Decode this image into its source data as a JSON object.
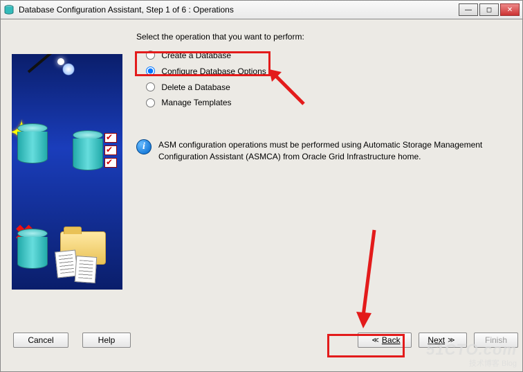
{
  "window": {
    "title": "Database Configuration Assistant, Step 1 of 6 : Operations"
  },
  "prompt": "Select the operation that you want to perform:",
  "options": {
    "create": {
      "label": "Create a Database",
      "value": "create"
    },
    "configure": {
      "label": "Configure Database Options",
      "value": "configure"
    },
    "delete": {
      "label": "Delete a Database",
      "value": "delete"
    },
    "manage": {
      "label": "Manage Templates",
      "value": "manage"
    }
  },
  "selected_option": "configure",
  "info": {
    "text": "ASM configuration operations must be performed using Automatic Storage Management Configuration Assistant (ASMCA) from Oracle Grid Infrastructure home."
  },
  "buttons": {
    "cancel": "Cancel",
    "help": "Help",
    "back": "Back",
    "next": "Next",
    "finish": "Finish"
  },
  "watermark": {
    "line1": "51CTO.com",
    "line2": "技术博客   Blog"
  }
}
